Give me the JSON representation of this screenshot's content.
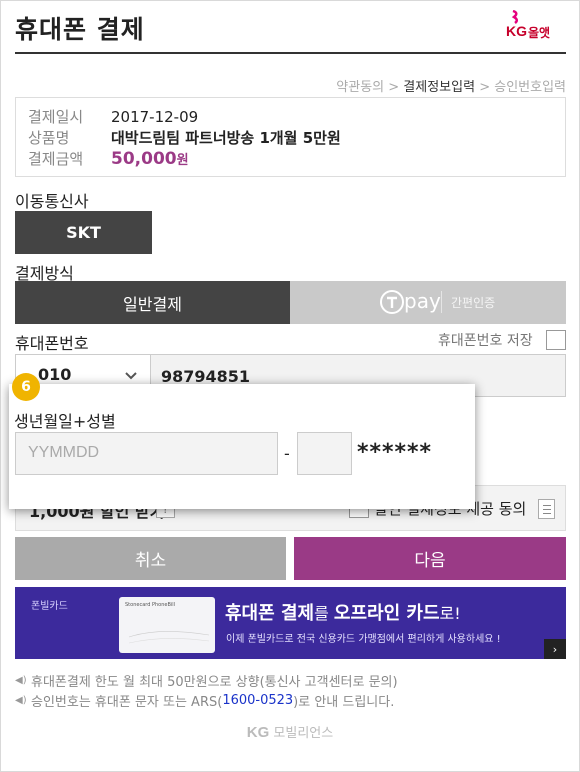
{
  "header": {
    "title": "휴대폰 결제",
    "logo_kg": "KG",
    "logo_name": "올앳"
  },
  "steps": {
    "step1": "약관동의",
    "sep": " > ",
    "step2": "결제정보입력",
    "step3": "승인번호입력"
  },
  "info": {
    "date_label": "결제일시",
    "date": "2017-12-09",
    "product_label": "상품명",
    "product": "대박드림팀 파트너방송 1개월 5만원",
    "amount_label": "결제금액",
    "amount": "50,000",
    "amount_unit": "원"
  },
  "carrier": {
    "label": "이동통신사",
    "selected": "SKT"
  },
  "method": {
    "label": "결제방식",
    "normal": "일반결제",
    "pay_text": "pay",
    "easy": "간편인증"
  },
  "phone": {
    "label": "휴대폰번호",
    "save_label": "휴대폰번호 저장",
    "prefix": "010",
    "number": "98794851"
  },
  "popup": {
    "step_badge": "6",
    "label": "생년월일+성별",
    "birth_placeholder": "YYMMDD",
    "dash": "-",
    "mask": "******"
  },
  "discount": {
    "label": "1,000원 할인 받기",
    "help": "?",
    "agree": "할인 결제정보 제공 동의"
  },
  "buttons": {
    "cancel": "취소",
    "next": "다음"
  },
  "banner": {
    "label": "폰빌카드",
    "card_text": "Stonecard PhoneBill",
    "headline_a": "휴대폰 결제",
    "headline_b": "를 ",
    "headline_c": "오프라인 카드",
    "headline_d": "로!",
    "sub": "이제 폰빌카드로 전국 신용카드 가맹점에서 편리하게 사용하세요 !",
    "arrow": "›"
  },
  "notes": {
    "line1": "휴대폰결제 한도 월 최대 50만원으로 상향(통신사 고객센터로 문의)",
    "line2_a": "승인번호는 휴대폰 문자 또는 ARS(",
    "line2_ars": "1600-0523",
    "line2_b": ")로 안내 드립니다."
  },
  "footer": {
    "kg": "KG",
    "name": "모빌리언스"
  },
  "colors": {
    "accent": "#9a3a86",
    "dark": "#444444",
    "badge": "#f0b400",
    "banner": "#3c2a9c"
  },
  "icons": {
    "select": "chevron-down-icon",
    "speaker": "speaker-icon",
    "list": "list-icon",
    "help": "question-icon"
  }
}
